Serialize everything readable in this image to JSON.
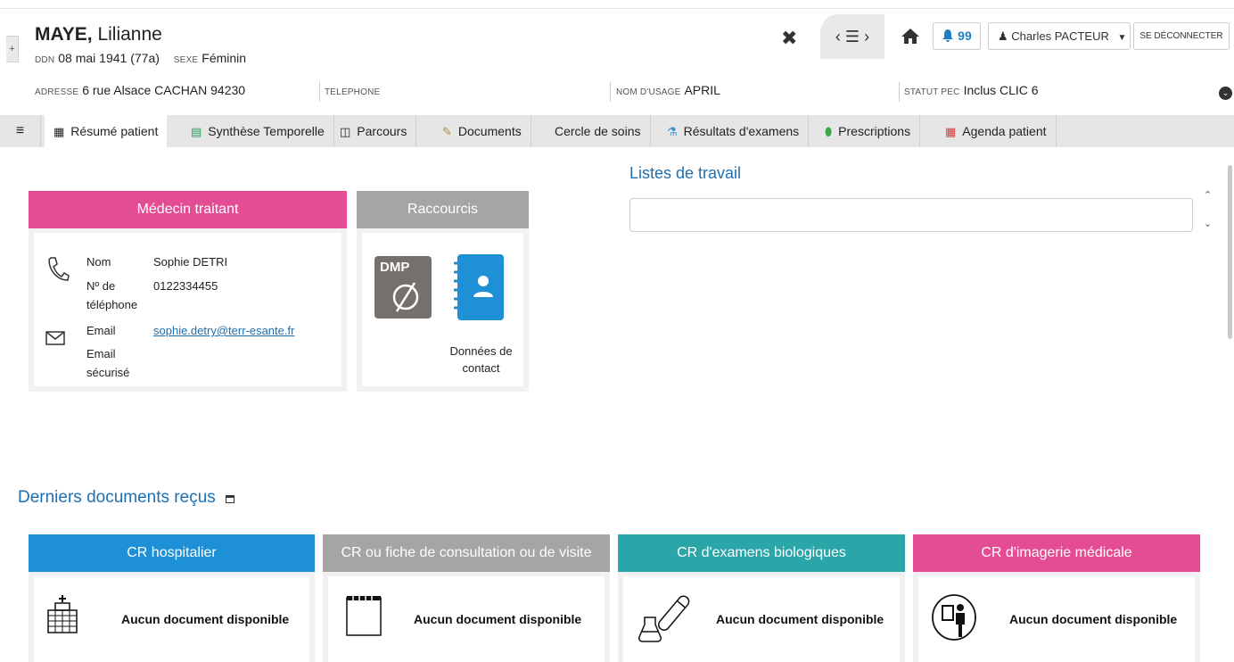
{
  "patient": {
    "last_name": "MAYE,",
    "first_name": "Lilianne",
    "ddn_label": "DDN",
    "ddn_value": "08 mai 1941 (77a)",
    "sexe_label": "SEXE",
    "sexe_value": "Féminin",
    "adresse_label": "ADRESSE",
    "adresse_value": "6 rue Alsace CACHAN 94230",
    "telephone_label": "TELEPHONE",
    "nom_usage_label": "NOM D'USAGE",
    "nom_usage_value": "APRIL",
    "statut_label": "STATUT PEC",
    "statut_value": "Inclus CLIC 6"
  },
  "header": {
    "notifications": "99",
    "user_name": "Charles PACTEUR",
    "logout": "SE DÉCONNECTER"
  },
  "tabs": [
    {
      "label": "Résumé patient"
    },
    {
      "label": "Synthèse Temporelle"
    },
    {
      "label": "Parcours"
    },
    {
      "label": "Documents"
    },
    {
      "label": "Cercle de soins"
    },
    {
      "label": "Résultats d'examens"
    },
    {
      "label": "Prescriptions"
    },
    {
      "label": "Agenda patient"
    }
  ],
  "medecin": {
    "title": "Médecin traitant",
    "nom_label": "Nom",
    "nom_value": "Sophie DETRI",
    "tel_label_1": "Nº de",
    "tel_label_2": "téléphone",
    "tel_value": "0122334455",
    "email_label": "Email",
    "email_value": "sophie.detry@terr-esante.fr",
    "email_sec_label_1": "Email",
    "email_sec_label_2": "sécurisé"
  },
  "raccourcis": {
    "title": "Raccourcis",
    "dmp_label": "DMP",
    "contact_label_1": "Données de",
    "contact_label_2": "contact"
  },
  "listes": {
    "title": "Listes de travail"
  },
  "documents": {
    "title": "Derniers documents reçus",
    "empty_message": "Aucun document disponible",
    "categories": [
      {
        "label": "CR hospitalier",
        "color": "#1e90d6"
      },
      {
        "label": "CR ou fiche de consultation ou de visite",
        "color": "#a5a5a5"
      },
      {
        "label": "CR d'examens biologiques",
        "color": "#2aa6a9"
      },
      {
        "label": "CR d'imagerie médicale",
        "color": "#e44c93"
      }
    ]
  },
  "colors": {
    "medecin_header": "#e44c93",
    "raccourcis_header": "#a5a5a5",
    "accent_blue": "#1e6fb0"
  }
}
